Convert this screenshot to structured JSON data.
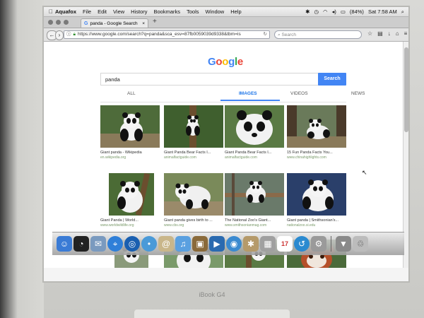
{
  "menubar": {
    "app": "Aquafox",
    "items": [
      "File",
      "Edit",
      "View",
      "History",
      "Bookmarks",
      "Tools",
      "Window",
      "Help"
    ],
    "battery": "(84%)",
    "clock": "Sat 7:58 AM"
  },
  "tabbar": {
    "tab_title": "panda - Google Search",
    "tab_close": "×",
    "new_tab": "+"
  },
  "navbar": {
    "url": "https://www.google.com/search?q=panda&sca_esv=87fb0059039d9338&tbm=is",
    "search_placeholder": "Search"
  },
  "google": {
    "logo": "Google",
    "query": "panda",
    "search_button": "Search",
    "tabs": [
      {
        "label": "ALL"
      },
      {
        "label": "IMAGES"
      },
      {
        "label": "VIDEOS"
      },
      {
        "label": "NEWS"
      }
    ],
    "active_tab": "IMAGES",
    "results": [
      {
        "title": "Giant panda - Wikipedia",
        "source": "en.wikipedia.org"
      },
      {
        "title": "Giant Panda Bear Facts I...",
        "source": "animalfactguide.com"
      },
      {
        "title": "Giant Panda Bear Facts I...",
        "source": "animalfactguide.com"
      },
      {
        "title": "15 Fun Panda Facts You...",
        "source": "www.chinahighlights.com"
      },
      {
        "title": "Giant Panda | World...",
        "source": "www.worldwildlife.org"
      },
      {
        "title": "Giant panda gives birth to ...",
        "source": "www.cbs.org"
      },
      {
        "title": "The National Zoo's Giant...",
        "source": "www.smithsonianmag.com"
      },
      {
        "title": "Giant panda | Smithsonian's...",
        "source": "nationalzoo.si.edu"
      },
      {
        "title": "",
        "source": ""
      },
      {
        "title": "",
        "source": ""
      },
      {
        "title": "",
        "source": ""
      },
      {
        "title": "",
        "source": ""
      }
    ]
  },
  "dock": {
    "icons": [
      "finder-icon",
      "dashboard-icon",
      "mail-icon",
      "safari-icon",
      "globe-icon",
      "ichat-icon",
      "itunes-icon",
      "preview-icon",
      "quicktime-icon",
      "firefox-icon",
      "iphoto-icon",
      "calendar-icon",
      "aquafox-icon",
      "systemprefs-icon",
      "trash-icon"
    ],
    "calendar_day": "17"
  },
  "laptop": {
    "model": "iBook G4"
  },
  "colors": {
    "accent": "#4285f4",
    "google_blue": "#4285f4",
    "google_red": "#ea4335",
    "google_yellow": "#fbbc05",
    "google_green": "#34a853"
  }
}
